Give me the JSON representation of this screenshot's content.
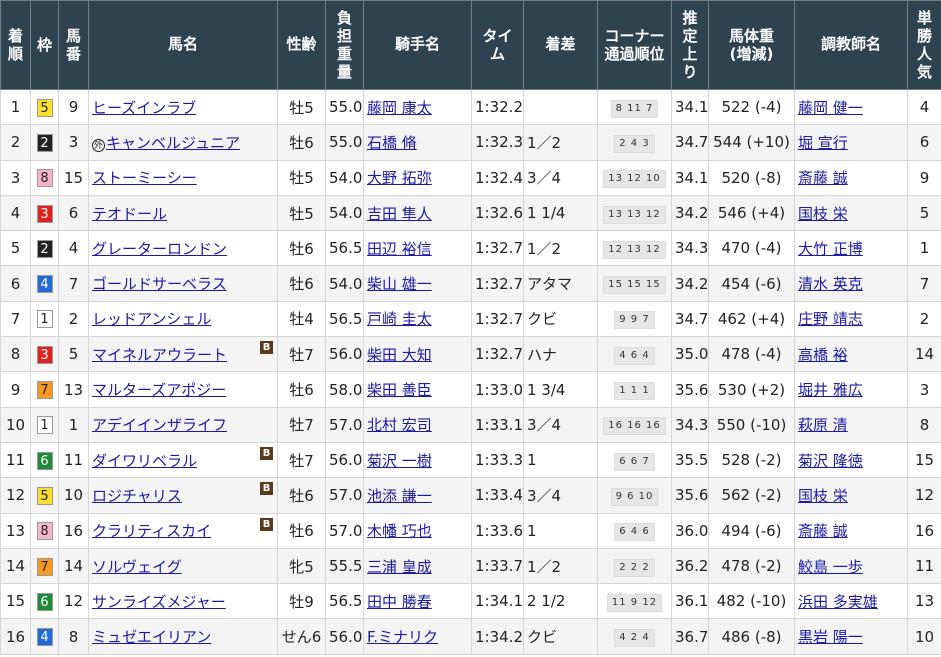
{
  "headers": [
    "着順",
    "枠",
    "馬番",
    "馬名",
    "性齢",
    "負担重量",
    "騎手名",
    "タイム",
    "着差",
    "コーナー通過順位",
    "推定上り",
    "馬体重(増減)",
    "調教師名",
    "単勝人気"
  ],
  "waku_colors": {
    "1": {
      "bg": "#ffffff",
      "fg": "#222222"
    },
    "2": {
      "bg": "#222222",
      "fg": "#ffffff"
    },
    "3": {
      "bg": "#e0221e",
      "fg": "#ffffff"
    },
    "4": {
      "bg": "#1f6ad6",
      "fg": "#ffffff"
    },
    "5": {
      "bg": "#f8e02a",
      "fg": "#222222"
    },
    "6": {
      "bg": "#1e8a3a",
      "fg": "#ffffff"
    },
    "7": {
      "bg": "#f59a1f",
      "fg": "#222222"
    },
    "8": {
      "bg": "#f7b6c8",
      "fg": "#222222"
    }
  },
  "blinker_label": "B",
  "foreign_mark": "外",
  "rows": [
    {
      "pos": "1",
      "waku": "5",
      "num": "9",
      "horse": "ヒーズインラブ",
      "blinker": false,
      "foreign": false,
      "sexage": "牡5",
      "weight": "55.0",
      "jockey": "藤岡 康太",
      "time": "1:32.2",
      "margin": "",
      "corners": "8 11 7",
      "last3f": "34.1",
      "bodyweight": "522 (-4)",
      "trainer": "藤岡 健一",
      "pop": "4"
    },
    {
      "pos": "2",
      "waku": "2",
      "num": "3",
      "horse": "キャンベルジュニア",
      "blinker": false,
      "foreign": true,
      "sexage": "牡6",
      "weight": "55.0",
      "jockey": "石橋 脩",
      "time": "1:32.3",
      "margin": "1／2",
      "corners": "2 4 3",
      "last3f": "34.7",
      "bodyweight": "544 (+10)",
      "trainer": "堀 宣行",
      "pop": "6"
    },
    {
      "pos": "3",
      "waku": "8",
      "num": "15",
      "horse": "ストーミーシー",
      "blinker": false,
      "foreign": false,
      "sexage": "牡5",
      "weight": "54.0",
      "jockey": "大野 拓弥",
      "time": "1:32.4",
      "margin": "3／4",
      "corners": "13 12 10",
      "last3f": "34.1",
      "bodyweight": "520 (-8)",
      "trainer": "斎藤 誠",
      "pop": "9"
    },
    {
      "pos": "4",
      "waku": "3",
      "num": "6",
      "horse": "テオドール",
      "blinker": false,
      "foreign": false,
      "sexage": "牡5",
      "weight": "54.0",
      "jockey": "吉田 隼人",
      "time": "1:32.6",
      "margin": "1 1/4",
      "corners": "13 13 12",
      "last3f": "34.2",
      "bodyweight": "546 (+4)",
      "trainer": "国枝 栄",
      "pop": "5"
    },
    {
      "pos": "5",
      "waku": "2",
      "num": "4",
      "horse": "グレーターロンドン",
      "blinker": false,
      "foreign": false,
      "sexage": "牡6",
      "weight": "56.5",
      "jockey": "田辺 裕信",
      "time": "1:32.7",
      "margin": "1／2",
      "corners": "12 13 12",
      "last3f": "34.3",
      "bodyweight": "470 (-4)",
      "trainer": "大竹 正博",
      "pop": "1"
    },
    {
      "pos": "6",
      "waku": "4",
      "num": "7",
      "horse": "ゴールドサーベラス",
      "blinker": false,
      "foreign": false,
      "sexage": "牡6",
      "weight": "54.0",
      "jockey": "柴山 雄一",
      "time": "1:32.7",
      "margin": "アタマ",
      "corners": "15 15 15",
      "last3f": "34.2",
      "bodyweight": "454 (-6)",
      "trainer": "清水 英克",
      "pop": "7"
    },
    {
      "pos": "7",
      "waku": "1",
      "num": "2",
      "horse": "レッドアンシェル",
      "blinker": false,
      "foreign": false,
      "sexage": "牡4",
      "weight": "56.5",
      "jockey": "戸崎 圭太",
      "time": "1:32.7",
      "margin": "クビ",
      "corners": "9 9 7",
      "last3f": "34.7",
      "bodyweight": "462 (+4)",
      "trainer": "庄野 靖志",
      "pop": "2"
    },
    {
      "pos": "8",
      "waku": "3",
      "num": "5",
      "horse": "マイネルアウラート",
      "blinker": true,
      "foreign": false,
      "sexage": "牡7",
      "weight": "56.0",
      "jockey": "柴田 大知",
      "time": "1:32.7",
      "margin": "ハナ",
      "corners": "4 6 4",
      "last3f": "35.0",
      "bodyweight": "478 (-4)",
      "trainer": "高橋 裕",
      "pop": "14"
    },
    {
      "pos": "9",
      "waku": "7",
      "num": "13",
      "horse": "マルターズアポジー",
      "blinker": false,
      "foreign": false,
      "sexage": "牡6",
      "weight": "58.0",
      "jockey": "柴田 善臣",
      "time": "1:33.0",
      "margin": "1 3/4",
      "corners": "1 1 1",
      "last3f": "35.6",
      "bodyweight": "530 (+2)",
      "trainer": "堀井 雅広",
      "pop": "3"
    },
    {
      "pos": "10",
      "waku": "1",
      "num": "1",
      "horse": "アデイインザライフ",
      "blinker": false,
      "foreign": false,
      "sexage": "牡7",
      "weight": "57.0",
      "jockey": "北村 宏司",
      "time": "1:33.1",
      "margin": "3／4",
      "corners": "16 16 16",
      "last3f": "34.3",
      "bodyweight": "550 (-10)",
      "trainer": "萩原 清",
      "pop": "8"
    },
    {
      "pos": "11",
      "waku": "6",
      "num": "11",
      "horse": "ダイワリベラル",
      "blinker": true,
      "foreign": false,
      "sexage": "牡7",
      "weight": "56.0",
      "jockey": "菊沢 一樹",
      "time": "1:33.3",
      "margin": "1",
      "corners": "6 6 7",
      "last3f": "35.5",
      "bodyweight": "528 (-2)",
      "trainer": "菊沢 隆徳",
      "pop": "15"
    },
    {
      "pos": "12",
      "waku": "5",
      "num": "10",
      "horse": "ロジチャリス",
      "blinker": true,
      "foreign": false,
      "sexage": "牡6",
      "weight": "57.0",
      "jockey": "池添 謙一",
      "time": "1:33.4",
      "margin": "3／4",
      "corners": "9 6 10",
      "last3f": "35.6",
      "bodyweight": "562 (-2)",
      "trainer": "国枝 栄",
      "pop": "12"
    },
    {
      "pos": "13",
      "waku": "8",
      "num": "16",
      "horse": "クラリティスカイ",
      "blinker": true,
      "foreign": false,
      "sexage": "牡6",
      "weight": "57.0",
      "jockey": "木幡 巧也",
      "time": "1:33.6",
      "margin": "1",
      "corners": "6 4 6",
      "last3f": "36.0",
      "bodyweight": "494 (-6)",
      "trainer": "斎藤 誠",
      "pop": "16"
    },
    {
      "pos": "14",
      "waku": "7",
      "num": "14",
      "horse": "ソルヴェイグ",
      "blinker": false,
      "foreign": false,
      "sexage": "牝5",
      "weight": "55.5",
      "jockey": "三浦 皇成",
      "time": "1:33.7",
      "margin": "1／2",
      "corners": "2 2 2",
      "last3f": "36.2",
      "bodyweight": "478 (-2)",
      "trainer": "鮫島 一歩",
      "pop": "11"
    },
    {
      "pos": "15",
      "waku": "6",
      "num": "12",
      "horse": "サンライズメジャー",
      "blinker": false,
      "foreign": false,
      "sexage": "牡9",
      "weight": "56.5",
      "jockey": "田中 勝春",
      "time": "1:34.1",
      "margin": "2 1/2",
      "corners": "11 9 12",
      "last3f": "36.1",
      "bodyweight": "482 (-10)",
      "trainer": "浜田 多実雄",
      "pop": "13"
    },
    {
      "pos": "16",
      "waku": "4",
      "num": "8",
      "horse": "ミュゼエイリアン",
      "blinker": false,
      "foreign": false,
      "sexage": "せん6",
      "weight": "56.0",
      "jockey": "F.ミナリク",
      "time": "1:34.2",
      "margin": "クビ",
      "corners": "4 2 4",
      "last3f": "36.7",
      "bodyweight": "486 (-8)",
      "trainer": "黒岩 陽一",
      "pop": "10"
    }
  ]
}
